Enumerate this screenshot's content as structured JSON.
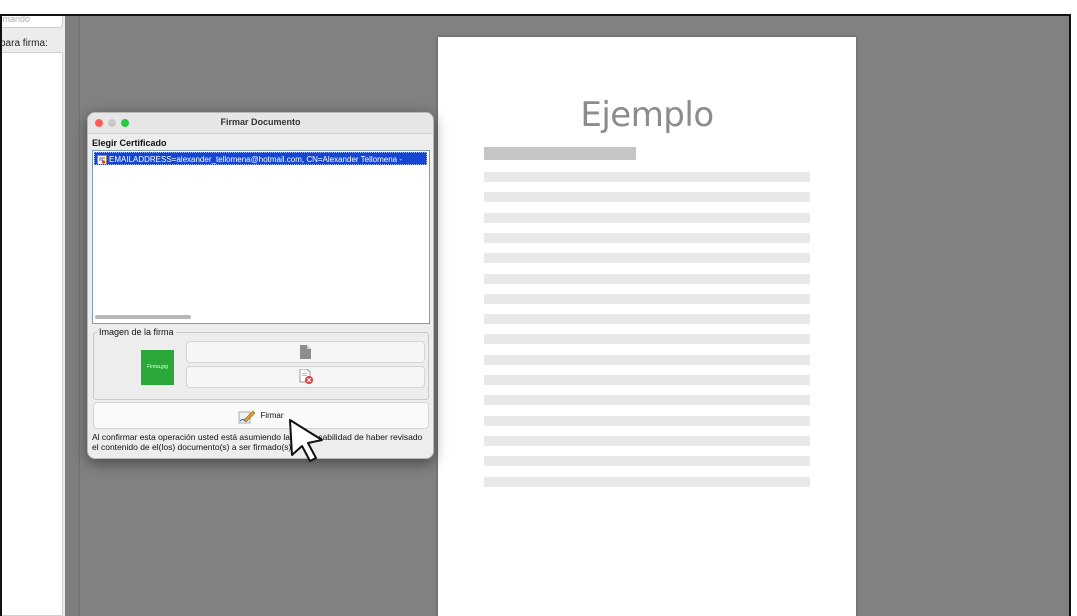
{
  "left_panel": {
    "field_placeholder": "Firmando",
    "label": "para firma:"
  },
  "document": {
    "title": "Ejemplo",
    "line_count": 16
  },
  "dialog": {
    "title": "Firmar Documento",
    "section_label": "Elegir Certificado",
    "certificates": [
      "EMAILADDRESS=alexander_tellomena@hotmail.com, CN=Alexander Tellomena - "
    ],
    "image_group_label": "Imagen de la firma",
    "thumbnail_text": "Firma.jpg",
    "sign_button_label": "Firmar",
    "notice": "Al confirmar esta operación usted está asumiendo la responsabilidad de haber revisado el contenido de el(los) documento(s) a ser firmado(s)."
  },
  "colors": {
    "selection": "#1546d3",
    "thumbnail": "#2aa83a",
    "close": "#ff5f57",
    "minimize": "#c9c9c9",
    "zoom": "#28c840"
  },
  "icons": [
    "certificate-icon",
    "file-icon",
    "remove-file-icon",
    "sign-pen-icon",
    "pointer-cursor-icon"
  ]
}
